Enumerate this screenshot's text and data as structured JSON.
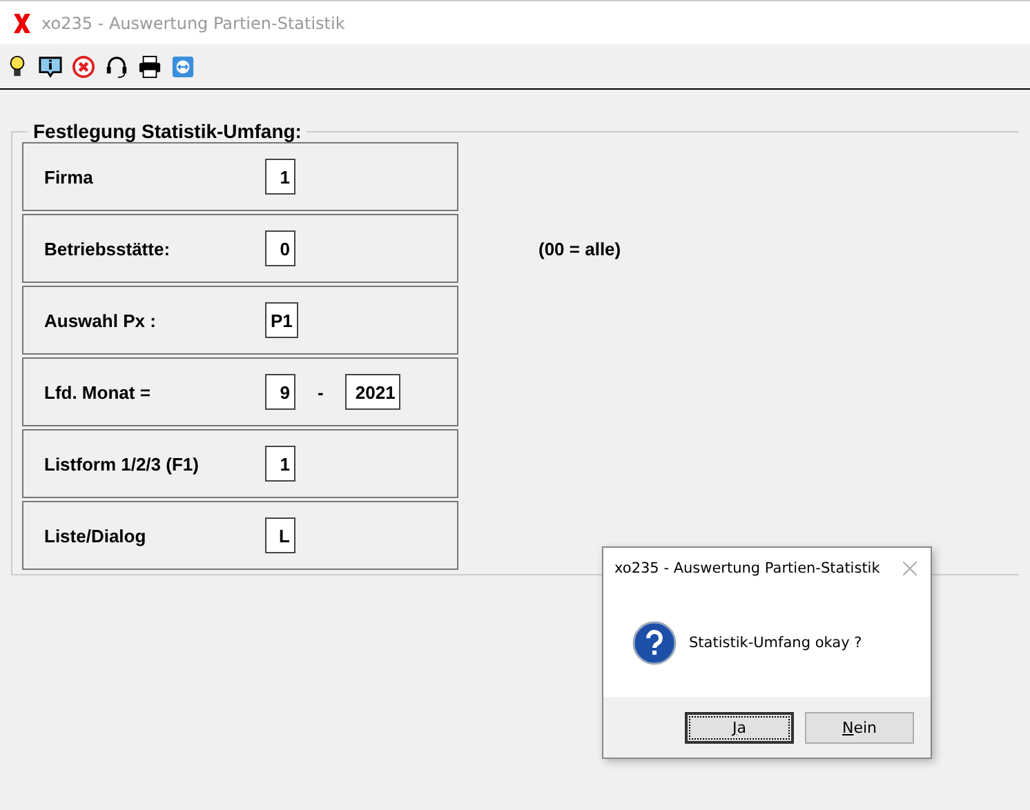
{
  "window": {
    "title": "xo235 - Auswertung Partien-Statistik"
  },
  "toolbar": [
    {
      "kind": "bulb"
    },
    {
      "kind": "info"
    },
    {
      "kind": "cancel"
    },
    {
      "kind": "headset"
    },
    {
      "kind": "print"
    },
    {
      "kind": "remote"
    }
  ],
  "group": {
    "title": "Festlegung Statistik-Umfang:",
    "rows": [
      {
        "label": "Firma",
        "fields": [
          "1"
        ]
      },
      {
        "label": "Betriebsstätte:",
        "fields": [
          "0"
        ],
        "note": "(00 = alle)"
      },
      {
        "label": "Auswahl Px :",
        "fields": [
          "P1"
        ]
      },
      {
        "label": "Lfd. Monat =",
        "fields": [
          "9",
          "2021"
        ],
        "separator": "-"
      },
      {
        "label": "Listform 1/2/3 (F1)",
        "fields": [
          "1"
        ]
      },
      {
        "label": "Liste/Dialog",
        "fields": [
          "L"
        ]
      }
    ]
  },
  "dialog": {
    "title": "xo235 - Auswertung Partien-Statistik",
    "message": "Statistik-Umfang okay ?",
    "buttons": [
      {
        "label": "Ja",
        "focused": true
      },
      {
        "label": "Nein",
        "focused": false
      }
    ]
  }
}
